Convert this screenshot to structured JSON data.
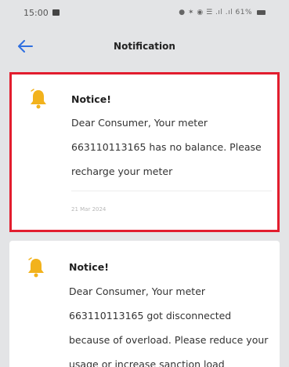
{
  "status_bar": {
    "time": "15:00",
    "right_text": "● ✶ ◉ ☰ .ıl .ıl 61%"
  },
  "header": {
    "title": "Notification"
  },
  "notifications": [
    {
      "title": "Notice!",
      "body": "Dear Consumer, Your meter 663110113165 has no balance. Please recharge your meter",
      "date": "21 Mar 2024",
      "highlighted": true
    },
    {
      "title": "Notice!",
      "body": "Dear Consumer, Your meter 663110113165 got disconnected because of overload. Please reduce your usage or increase sanction load",
      "highlighted": false
    }
  ],
  "colors": {
    "accent": "#2f6fe0",
    "highlight_border": "#e21d2e",
    "bell": "#f2b21c",
    "background": "#e3e4e6"
  },
  "icons": {
    "back": "arrow-left-icon",
    "bell": "bell-icon"
  }
}
